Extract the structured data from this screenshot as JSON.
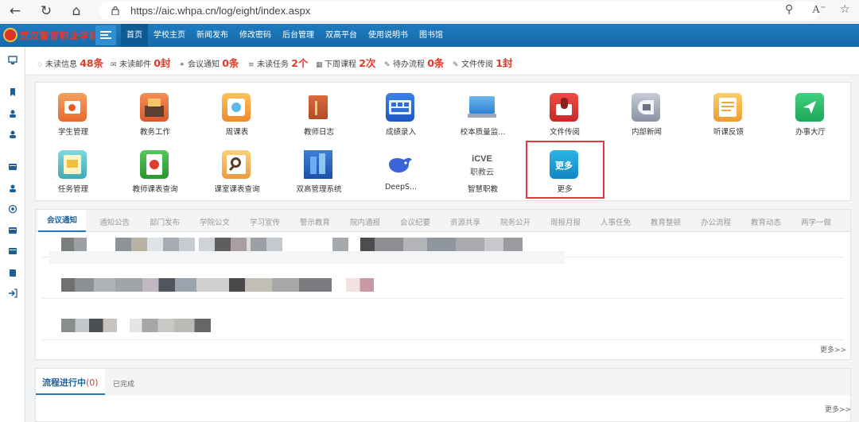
{
  "browser": {
    "url": "https://aic.whpa.cn/log/eight/index.aspx",
    "back_icon": "arrow-left-icon",
    "reload_icon": "reload-icon",
    "home_icon": "home-icon"
  },
  "app": {
    "logo_text": "武汉警官职业学院",
    "nav": [
      "首页",
      "学校主页",
      "新闻发布",
      "修改密码",
      "后台管理",
      "双高平台",
      "使用说明书",
      "图书馆"
    ],
    "active_nav": "首页"
  },
  "notices": [
    {
      "label": "未读信息",
      "value": "48条",
      "icon": "bell-icon"
    },
    {
      "label": "未读邮件",
      "value": "0封",
      "icon": "mail-icon"
    },
    {
      "label": "会议通知",
      "value": "0条",
      "icon": "chat-icon"
    },
    {
      "label": "未读任务",
      "value": "2个",
      "icon": "list-icon"
    },
    {
      "label": "下周课程",
      "value": "2次",
      "icon": "calendar-icon"
    },
    {
      "label": "待办流程",
      "value": "0条",
      "icon": "edit-icon"
    },
    {
      "label": "文件传阅",
      "value": "1封",
      "icon": "edit-icon"
    }
  ],
  "apps": [
    {
      "label": "学生管理",
      "color": "#f07c3a"
    },
    {
      "label": "教务工作",
      "color": "#e8753a"
    },
    {
      "label": "周课表",
      "color": "#f39a3d"
    },
    {
      "label": "教师日志",
      "color": "#c85a34"
    },
    {
      "label": "成绩录入",
      "color": "#2d6fd6"
    },
    {
      "label": "校本质量监...",
      "color": "#3c8fe0"
    },
    {
      "label": "文件传阅",
      "color": "#d93a35"
    },
    {
      "label": "内部新闻",
      "color": "#8a93a6"
    },
    {
      "label": "听课反馈",
      "color": "#f0a53a"
    },
    {
      "label": "办事大厅",
      "color": "#2bbd6b"
    },
    {
      "label": "任务管理",
      "color": "#52c0c8"
    },
    {
      "label": "教师课表查询",
      "color": "#37a93f"
    },
    {
      "label": "课室课表查询",
      "color": "#f0a444"
    },
    {
      "label": "双高管理系统",
      "color": "#2e6ec2"
    },
    {
      "label": "DeepS...",
      "color": "#3d63d9"
    },
    {
      "label": "智慧职教",
      "color": "#ffffff"
    },
    {
      "label": "更多",
      "color": "#1aa0d8"
    }
  ],
  "icve": {
    "top": "iCVE",
    "bottom": "职教云"
  },
  "more_icon_text": "更多",
  "news": {
    "tabs": [
      "会议通知",
      "通知公告",
      "部门发布",
      "学院公文",
      "学习宣传",
      "警示教育",
      "院内通报",
      "会议纪要",
      "资源共享",
      "院务公开",
      "周报月报",
      "人事任免",
      "教育整顿",
      "办公流程",
      "教育动态",
      "两学一做"
    ],
    "active_tab": "会议通知",
    "more": "更多>>"
  },
  "process": {
    "active_tab": "流程进行中",
    "count": "(0)",
    "second_tab": "已完成",
    "more": "更多>>"
  }
}
